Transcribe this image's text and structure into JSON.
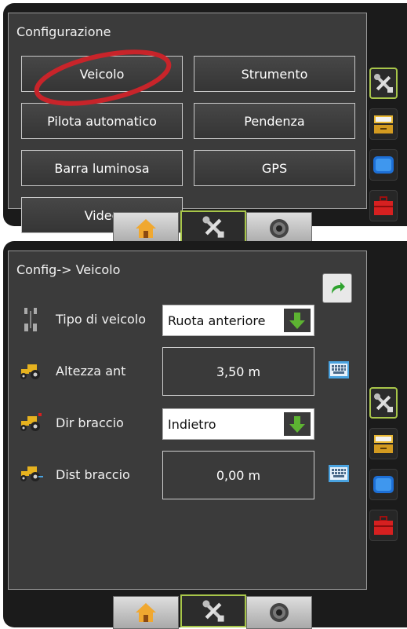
{
  "screen1": {
    "title": "Configurazione",
    "buttons": [
      {
        "label": "Veicolo"
      },
      {
        "label": "Strumento"
      },
      {
        "label": "Pilota automatico"
      },
      {
        "label": "Pendenza"
      },
      {
        "label": "Barra luminosa"
      },
      {
        "label": "GPS"
      },
      {
        "label": "Video"
      }
    ],
    "highlight_color": "#c8242a"
  },
  "screen2": {
    "title": "Config-> Veicolo",
    "rows": [
      {
        "label": "Tipo di veicolo",
        "value": "Ruota anteriore",
        "control": "dropdown"
      },
      {
        "label": "Altezza ant",
        "value": "3,50 m",
        "control": "keypad"
      },
      {
        "label": "Dir braccio",
        "value": "Indietro",
        "control": "dropdown"
      },
      {
        "label": "Dist braccio",
        "value": "0,00 m",
        "control": "keypad"
      }
    ]
  },
  "side_icons": [
    "tools-icon",
    "drawer-icon",
    "display-icon",
    "toolbox-icon"
  ],
  "bottom_nav": [
    "home-icon",
    "tools-icon",
    "camera-icon"
  ],
  "colors": {
    "active_border": "#a8c64a",
    "panel": "#3b3b3b",
    "dropdown_arrow": "#5db332"
  }
}
